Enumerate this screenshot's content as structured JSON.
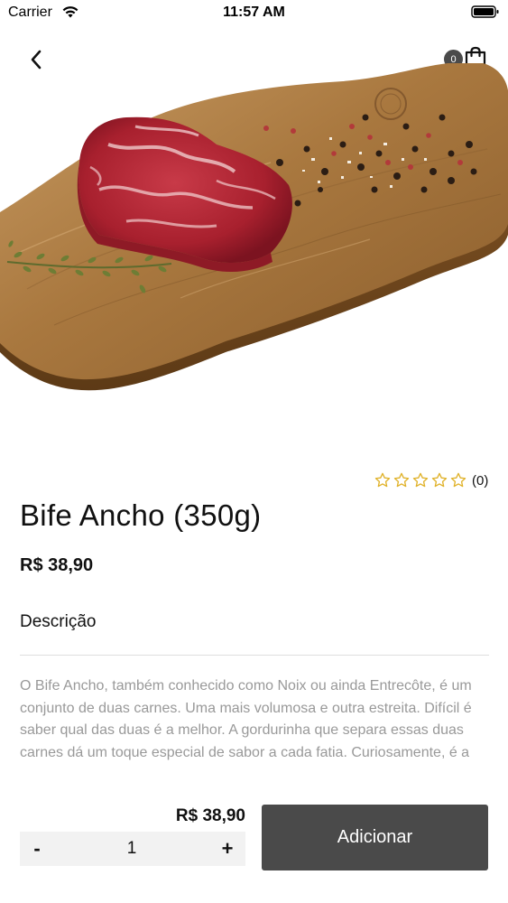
{
  "status_bar": {
    "carrier": "Carrier",
    "time": "11:57 AM"
  },
  "nav": {
    "back_icon": "chevron-left-icon",
    "cart_icon": "shopping-bag-icon",
    "cart_count": "0"
  },
  "product": {
    "image_alt": "raw-ribeye-steak-on-wooden-board",
    "rating_stars": 0,
    "rating_max": 5,
    "rating_count": "(0)",
    "name": "Bife Ancho (350g)",
    "price": "R$ 38,90",
    "description_heading": "Descrição",
    "description": "O Bife Ancho, também conhecido como Noix ou ainda Entrecôte, é um conjunto de duas carnes. Uma mais volumosa e outra estreita. Difícil é saber qual das duas é a melhor. A gordurinha que separa essas duas carnes dá um toque especial de sabor a cada fatia. Curiosamente, é a"
  },
  "footer": {
    "total_price": "R$ 38,90",
    "minus_label": "-",
    "quantity": "1",
    "plus_label": "+",
    "add_button_label": "Adicionar"
  },
  "colors": {
    "accent_dark": "#4a4a4a",
    "star_outline": "#e0b22a",
    "muted_text": "#999999",
    "stepper_bg": "#f2f2f2"
  }
}
